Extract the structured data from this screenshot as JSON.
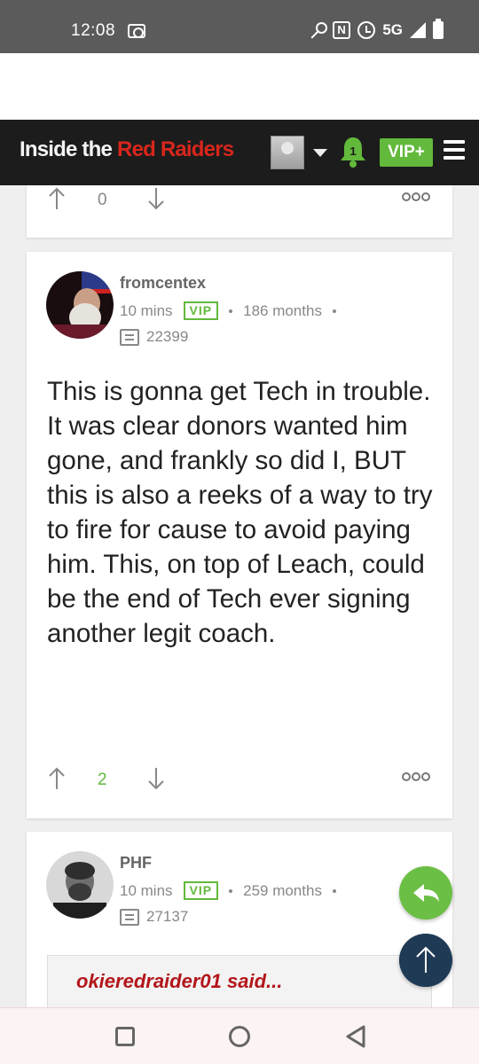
{
  "status_bar": {
    "time": "12:08",
    "network": "5G"
  },
  "header": {
    "logo_part1": "Inside the",
    "logo_part2": "Red Raiders",
    "notification_count": "1",
    "vip_button": "VIP+",
    "colors": {
      "background": "#1c1c1c",
      "logo_red": "#d8261c",
      "accent_green": "#62b93b"
    }
  },
  "prev_post": {
    "vote_count": "0"
  },
  "post": {
    "username": "fromcentex",
    "time_ago": "10 mins",
    "badge": "VIP",
    "membership": "186 months",
    "message_count": "22399",
    "body": "This is gonna get Tech in trouble. It was clear donors wanted him gone, and frankly so did I, BUT this is also a reeks of a way to try to fire for cause to avoid paying him. This, on top of Leach, could be the end of Tech ever signing another legit coach.",
    "vote_count": "2"
  },
  "next_post": {
    "username": "PHF",
    "time_ago": "10 mins",
    "badge": "VIP",
    "membership": "259 months",
    "message_count": "27137",
    "quote_author": "okieredraider01 said..."
  },
  "icons": [
    "key-icon",
    "nfc-icon",
    "alarm-icon",
    "signal-icon",
    "battery-icon",
    "bell-icon",
    "menu-icon",
    "reply-icon",
    "scroll-top-icon",
    "recent-apps-icon",
    "home-icon",
    "back-icon"
  ]
}
